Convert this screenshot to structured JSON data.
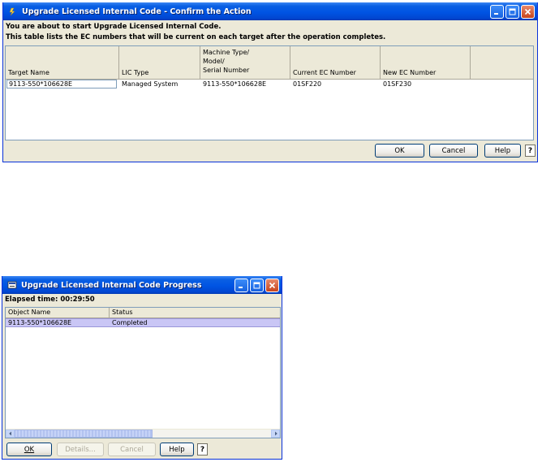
{
  "confirm_window": {
    "title": "Upgrade Licensed Internal Code - Confirm the Action",
    "intro_line1": "You are about to start Upgrade Licensed Internal Code.",
    "intro_line2": "This table lists the EC numbers that will be current on each target after the operation completes.",
    "columns": {
      "target_name": "Target Name",
      "lic_type": "LIC Type",
      "machine_line1": "Machine Type/",
      "machine_line2": "Model/",
      "machine_line3": "Serial Number",
      "current_ec": "Current EC Number",
      "new_ec": "New EC Number"
    },
    "rows": [
      {
        "target_name": "9113-550*106628E",
        "lic_type": "Managed System",
        "machine": "9113-550*106628E",
        "current_ec": "01SF220",
        "new_ec": "01SF230"
      }
    ],
    "buttons": {
      "ok": "OK",
      "cancel": "Cancel",
      "help": "Help",
      "question": "?"
    }
  },
  "progress_window": {
    "title": "Upgrade Licensed Internal Code Progress",
    "elapsed_label": "Elapsed time:",
    "elapsed_value": "00:29:50",
    "columns": {
      "object_name": "Object Name",
      "status": "Status"
    },
    "rows": [
      {
        "object_name": "9113-550*106628E",
        "status": "Completed"
      }
    ],
    "buttons": {
      "ok": "OK",
      "details": "Details...",
      "cancel": "Cancel",
      "help": "Help",
      "question": "?"
    }
  },
  "colors": {
    "title_bar": "#0054e3",
    "window_bg": "#ece9d8",
    "selection": "#c9c6f5",
    "close_button": "#c8451d"
  },
  "icons": [
    "app-icon",
    "minimize-icon",
    "maximize-icon",
    "close-icon",
    "scroll-left-icon",
    "scroll-right-icon"
  ]
}
